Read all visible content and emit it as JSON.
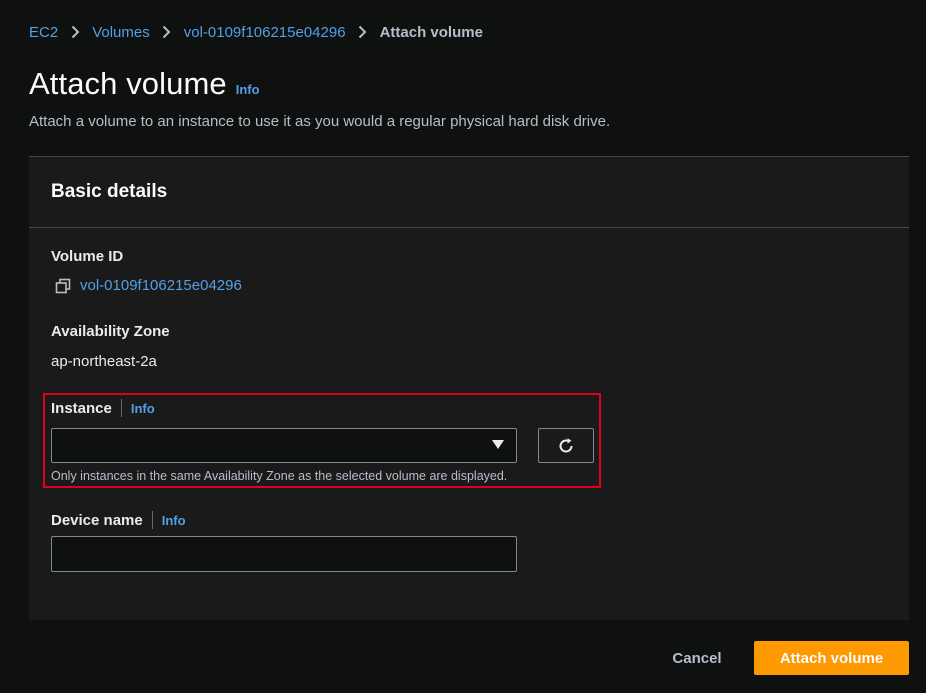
{
  "breadcrumb": {
    "items": [
      "EC2",
      "Volumes",
      "vol-0109f106215e04296"
    ],
    "current": "Attach volume"
  },
  "header": {
    "title": "Attach volume",
    "info": "Info",
    "description": "Attach a volume to an instance to use it as you would a regular physical hard disk drive."
  },
  "panel": {
    "title": "Basic details",
    "volume_id": {
      "label": "Volume ID",
      "value": "vol-0109f106215e04296"
    },
    "availability_zone": {
      "label": "Availability Zone",
      "value": "ap-northeast-2a"
    },
    "instance": {
      "label": "Instance",
      "info": "Info",
      "selected": "",
      "constraint": "Only instances in the same Availability Zone as the selected volume are displayed."
    },
    "device_name": {
      "label": "Device name",
      "info": "Info",
      "value": ""
    }
  },
  "actions": {
    "cancel": "Cancel",
    "submit": "Attach volume"
  },
  "colors": {
    "accent": "#ff9900",
    "link": "#539fe5",
    "highlight": "#e0001b",
    "background": "#0f1010",
    "panel": "#1a1a1a"
  }
}
